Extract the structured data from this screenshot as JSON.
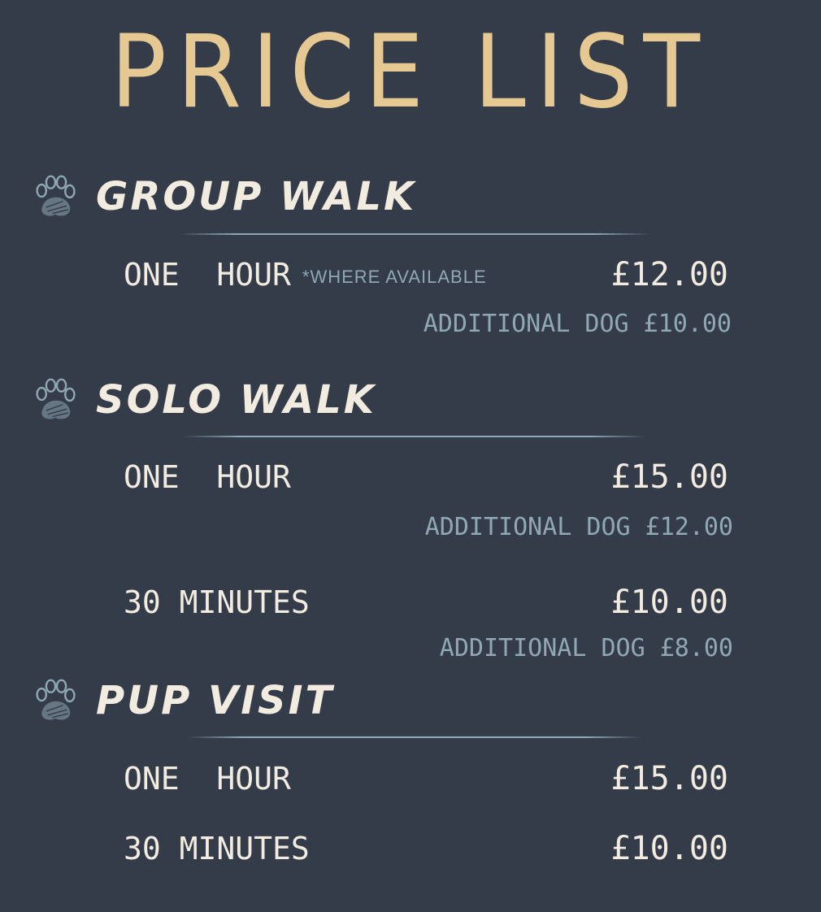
{
  "title": "PRICE LIST",
  "colors": {
    "background": "#343b49",
    "title": "#e6c992",
    "text": "#f1ebe0",
    "muted": "#8fa8b4"
  },
  "sections": [
    {
      "name": "GROUP WALK",
      "icon": "paw-icon",
      "items": [
        {
          "label": "ONE  HOUR",
          "note": "*WHERE AVAILABLE",
          "price": "£12.00",
          "additional": "ADDITIONAL DOG £10.00"
        }
      ]
    },
    {
      "name": "SOLO WALK",
      "icon": "paw-icon",
      "items": [
        {
          "label": "ONE  HOUR",
          "price": "£15.00",
          "additional": "ADDITIONAL DOG £12.00"
        },
        {
          "label": "30 MINUTES",
          "price": "£10.00",
          "additional": "ADDITIONAL DOG £8.00"
        }
      ]
    },
    {
      "name": "PUP VISIT",
      "icon": "paw-icon",
      "items": [
        {
          "label": "ONE  HOUR",
          "price": "£15.00"
        },
        {
          "label": "30 MINUTES",
          "price": "£10.00"
        }
      ]
    }
  ]
}
